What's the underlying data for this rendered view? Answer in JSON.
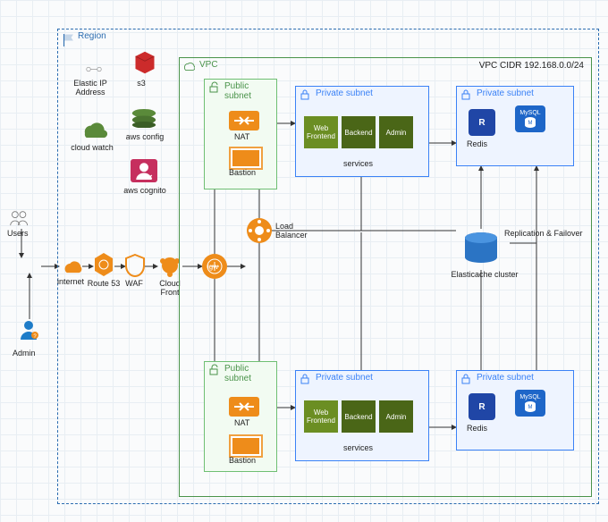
{
  "region": "Region",
  "vpc": {
    "label": "VPC",
    "cidr": "VPC CIDR 192.168.0.0/24"
  },
  "left": {
    "users": "Users",
    "admin": "Admin",
    "internet": "internet",
    "route53": "Route 53",
    "waf": "WAF",
    "cloudfront": "Cloud Front"
  },
  "aux": {
    "eip": "Elastic IP Address",
    "s3": "s3",
    "cloudwatch": "cloud watch",
    "awsconfig": "aws config",
    "cognito": "aws cognito"
  },
  "subnets": {
    "pub1": "Public subnet",
    "pub2": "Public subnet",
    "priv_app1": "Private subnet",
    "priv_app2": "Private subnet",
    "priv_db1": "Private subnet",
    "priv_db2": "Private subnet"
  },
  "nodes": {
    "nat": "NAT",
    "bastion": "Bastion",
    "igw": "igw",
    "lb": "Load Balancer",
    "web": "Web Frontend",
    "backend": "Backend",
    "admin": "Admin",
    "services": "services",
    "redis": "Redis",
    "mysql": "MySQL",
    "elasticache": "Elasticache cluster",
    "replication": "Replication & Failover"
  }
}
